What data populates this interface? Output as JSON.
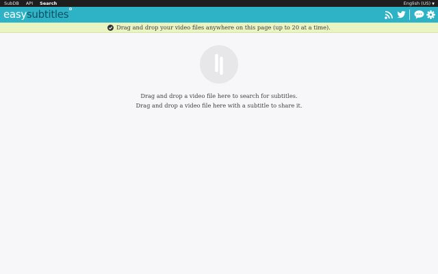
{
  "topbar": {
    "nav": [
      "SubDB",
      "API",
      "Search"
    ],
    "active_index": 2,
    "language": "English (US)",
    "language_caret": "▼"
  },
  "header": {
    "logo_part1": "easy",
    "logo_part2": "subtitles",
    "icons": [
      "rss-icon",
      "twitter-icon",
      "chat-icon",
      "gear-icon"
    ]
  },
  "notice": {
    "text": "Drag and drop your video files anywhere on this page (up to 20 at a time).",
    "icon": "check-circle-icon"
  },
  "main": {
    "drop_icon": "drag-drop-icon",
    "line1": "Drag and drop a video file here to search for subtitles.",
    "line2": "Drag and drop a video file here with a subtitle to share it."
  },
  "colors": {
    "topbar": "#1e1e1e",
    "header": "#2eb3c6",
    "logo_dark": "#0d4f63",
    "notice_bg": "#eaf3c2",
    "page_bg": "#f7f6f9"
  }
}
